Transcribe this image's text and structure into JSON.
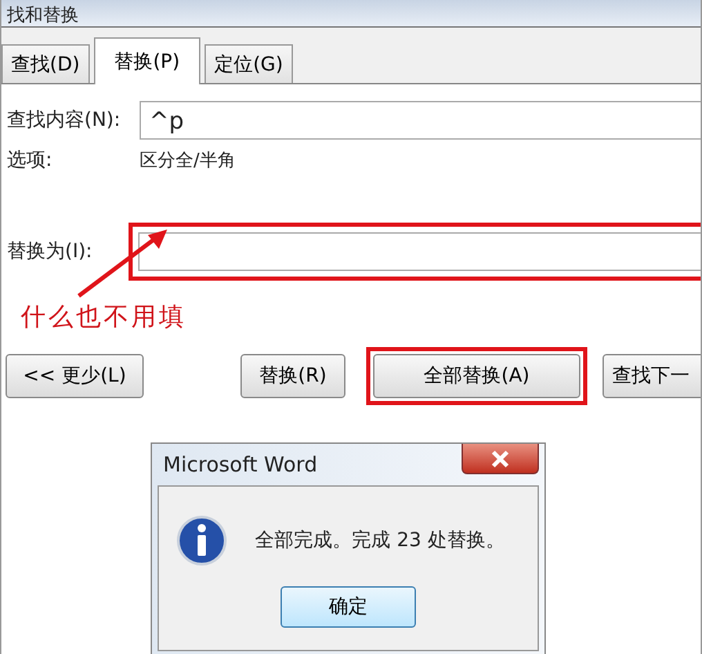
{
  "window": {
    "title": "找和替换"
  },
  "tabs": [
    {
      "label": "查找(D)",
      "selected": false
    },
    {
      "label": "替换(P)",
      "selected": true
    },
    {
      "label": "定位(G)",
      "selected": false
    }
  ],
  "find_field": {
    "label": "查找内容(N):",
    "value": "^p"
  },
  "options": {
    "label": "选项:",
    "value": "区分全/半角"
  },
  "replace_field": {
    "label": "替换为(I):",
    "highlighted": true
  },
  "annotation": {
    "text": "什么也不用填"
  },
  "buttons": [
    {
      "label": "<< 更少(L)",
      "highlighted": false
    },
    {
      "label": "替换(R)",
      "highlighted": false
    },
    {
      "label": "全部替换(A)",
      "highlighted": true
    },
    {
      "label": "查找下一",
      "highlighted": false
    }
  ],
  "message_box": {
    "title": "Microsoft Word",
    "message": "全部完成。完成 23 处替换。",
    "ok_button": "确定"
  }
}
